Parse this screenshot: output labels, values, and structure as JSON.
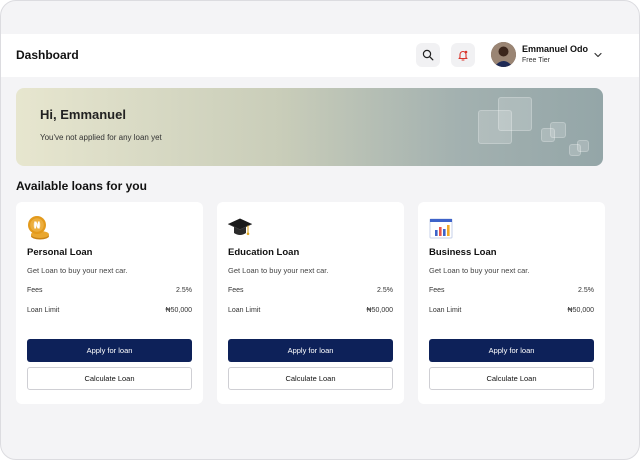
{
  "header": {
    "title": "Dashboard",
    "user_name": "Emmanuel Odo",
    "user_tier": "Free Tier"
  },
  "banner": {
    "greeting": "Hi, Emmanuel",
    "message": "You've not applied for any loan yet"
  },
  "section": {
    "title": "Available loans for you"
  },
  "loans": [
    {
      "title": "Personal Loan",
      "description": "Get Loan to buy your next car.",
      "fees_label": "Fees",
      "fees_value": "2.5%",
      "limit_label": "Loan Limit",
      "limit_value": "₦50,000",
      "apply_label": "Apply for loan",
      "calc_label": "Calculate Loan",
      "icon": "naira-coin-icon"
    },
    {
      "title": "Education Loan",
      "description": "Get Loan to buy your next car.",
      "fees_label": "Fees",
      "fees_value": "2.5%",
      "limit_label": "Loan Limit",
      "limit_value": "₦50,000",
      "apply_label": "Apply for loan",
      "calc_label": "Calculate Loan",
      "icon": "graduation-cap-icon"
    },
    {
      "title": "Business Loan",
      "description": "Get Loan to buy your next car.",
      "fees_label": "Fees",
      "fees_value": "2.5%",
      "limit_label": "Loan Limit",
      "limit_value": "₦50,000",
      "apply_label": "Apply for loan",
      "calc_label": "Calculate Loan",
      "icon": "bar-chart-board-icon"
    }
  ],
  "colors": {
    "primary_button": "#0d2159",
    "coin": "#e39a1c",
    "background": "#f4f4f6"
  }
}
